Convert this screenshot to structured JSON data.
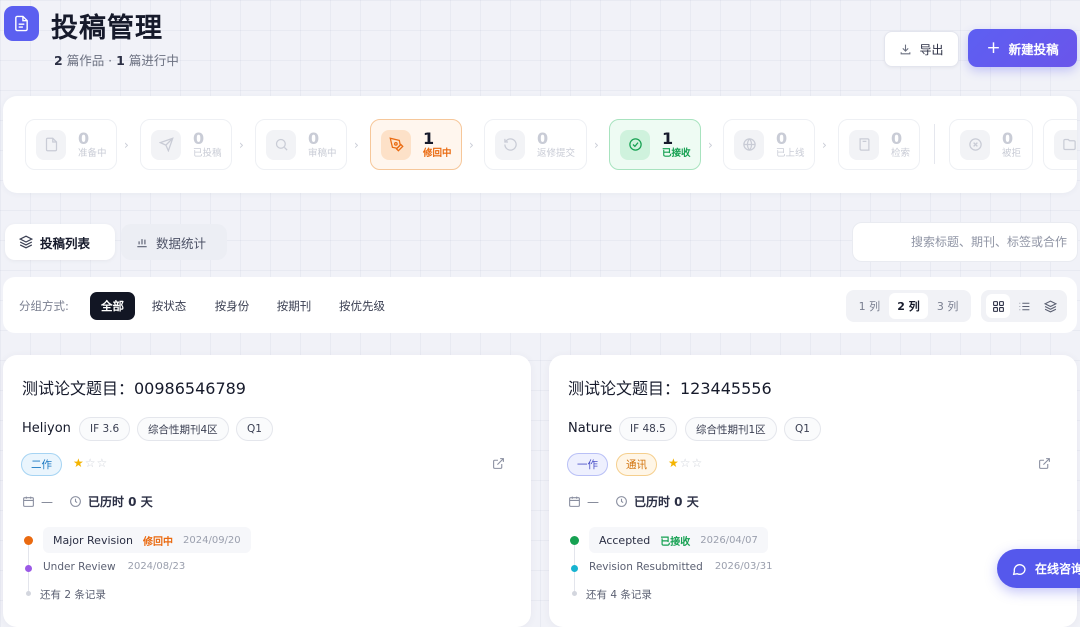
{
  "header": {
    "title": "投稿管理",
    "subtitle_count_works": "2",
    "subtitle_works": "篇作品 ·",
    "subtitle_count_progress": "1",
    "subtitle_progress": "篇进行中",
    "export_label": "导出",
    "new_label": "新建投稿",
    "accent": "#5b5ff0"
  },
  "statuses": [
    {
      "count": "0",
      "label": "准备中",
      "icon": "document-icon"
    },
    {
      "count": "0",
      "label": "已投稿",
      "icon": "send-icon"
    },
    {
      "count": "0",
      "label": "审稿中",
      "icon": "search-icon"
    },
    {
      "count": "1",
      "label": "修回中",
      "icon": "pen-icon",
      "active": "orange"
    },
    {
      "count": "0",
      "label": "返修提交",
      "icon": "refresh-icon"
    },
    {
      "count": "1",
      "label": "已接收",
      "icon": "check-circle-icon",
      "active": "green"
    },
    {
      "count": "0",
      "label": "已上线",
      "icon": "globe-icon"
    },
    {
      "count": "0",
      "label": "检索",
      "icon": "book-icon"
    },
    {
      "count": "0",
      "label": "被拒",
      "icon": "x-circle-icon"
    }
  ],
  "tabs": {
    "list": "投稿列表",
    "stats": "数据统计"
  },
  "search": {
    "placeholder": "搜索标题、期刊、标签或合作"
  },
  "grouping": {
    "label": "分组方式:",
    "options": [
      "全部",
      "按状态",
      "按身份",
      "按期刊",
      "按优先级"
    ],
    "selected": "全部",
    "columns": [
      "1 列",
      "2 列",
      "3 列"
    ],
    "selected_columns": "2 列"
  },
  "cards": [
    {
      "title": "测试论文题目：00986546789",
      "journal": "Heliyon",
      "impact": "IF 3.6",
      "category": "综合性期刊4区",
      "quartile": "Q1",
      "roles": [
        "二作"
      ],
      "rating": 1,
      "date": "—",
      "elapsed": "已历时 0 天",
      "latest": {
        "event": "Major Revision",
        "status": "修回中",
        "date": "2024/09/20"
      },
      "previous": {
        "event": "Under Review",
        "date": "2024/08/23"
      },
      "more": "还有 2 条记录"
    },
    {
      "title": "测试论文题目：123445556",
      "journal": "Nature",
      "impact": "IF 48.5",
      "category": "综合性期刊1区",
      "quartile": "Q1",
      "roles": [
        "一作",
        "通讯"
      ],
      "rating": 1,
      "date": "—",
      "elapsed": "已历时 0 天",
      "latest": {
        "event": "Accepted",
        "status": "已接收",
        "date": "2026/04/07"
      },
      "previous": {
        "event": "Revision Resubmitted",
        "date": "2026/03/31"
      },
      "more": "还有 4 条记录"
    }
  ],
  "consult_label": "在线咨询"
}
